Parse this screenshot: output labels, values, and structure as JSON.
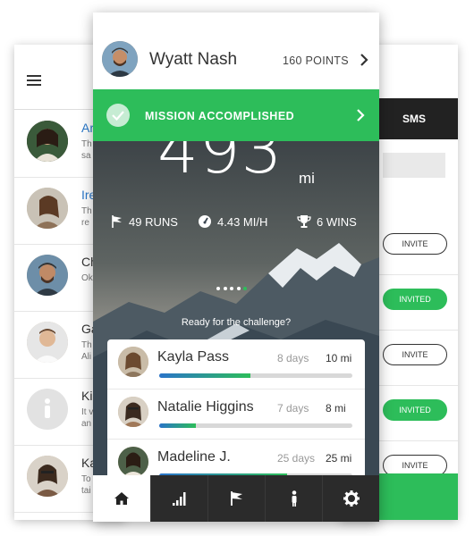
{
  "back_left": {
    "contacts": [
      {
        "name": "Ar",
        "line1": "Th",
        "line2": "sa"
      },
      {
        "name": "Ire",
        "line1": "Th",
        "line2": "re"
      },
      {
        "name": "Ch",
        "line1": "Ok",
        "line2": ""
      },
      {
        "name": "Ga",
        "line1": "Th",
        "line2": "Ali"
      },
      {
        "name": "Ki",
        "line1": "It v",
        "line2": "an"
      },
      {
        "name": "Ka",
        "line1": "To",
        "line2": "tai"
      }
    ]
  },
  "back_right": {
    "tab_label": "SMS",
    "invite_buttons": [
      "INVITE",
      "INVITED",
      "INVITE",
      "INVITED",
      "INVITE"
    ]
  },
  "profile": {
    "name": "Wyatt Nash",
    "points": "160 POINTS"
  },
  "banner": {
    "text": "MISSION ACCOMPLISHED"
  },
  "hero": {
    "distance": "493",
    "unit": "mi",
    "stats": {
      "runs": "49 RUNS",
      "speed": "4.43 MI/H",
      "wins": "6 WINS"
    },
    "carousel": {
      "count": 5,
      "active": 4
    },
    "prompt": "Ready for the challenge?"
  },
  "leaderboard": [
    {
      "name": "Kayla Pass",
      "days": "8 days",
      "miles": "10 mi",
      "progress": 0.47
    },
    {
      "name": "Natalie Higgins",
      "days": "7 days",
      "miles": "8 mi",
      "progress": 0.19
    },
    {
      "name": "Madeline J.",
      "days": "25 days",
      "miles": "25 mi",
      "progress": 0.66
    }
  ],
  "tabbar": {
    "icons": [
      "home-icon",
      "stats-icon",
      "flag-icon",
      "person-icon",
      "settings-icon"
    ]
  },
  "colors": {
    "accent_green": "#2dbd5a",
    "progress_blue": "#2a74c9",
    "tabbar_dark": "#2b2b2b"
  }
}
